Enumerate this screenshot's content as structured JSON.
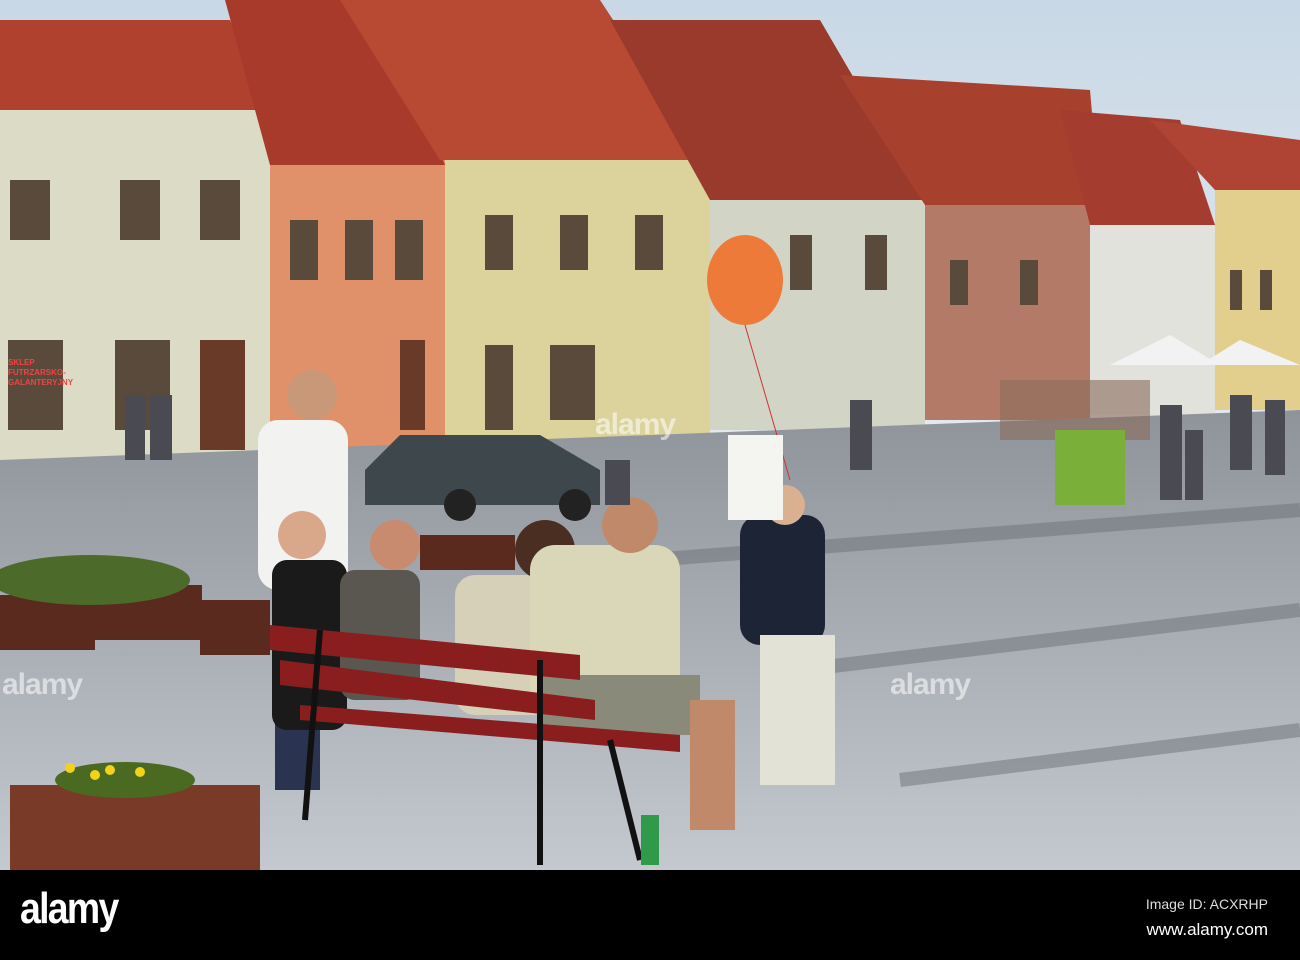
{
  "photo": {
    "shop_sign": "SKLEP FUTRZARSKO-GALANTERYJNY",
    "watermarks": [
      "alamy",
      "alamy",
      "alamy"
    ]
  },
  "footer": {
    "logo": "alamy",
    "image_id": "Image ID: ACXRHP",
    "url": "www.alamy.com"
  }
}
